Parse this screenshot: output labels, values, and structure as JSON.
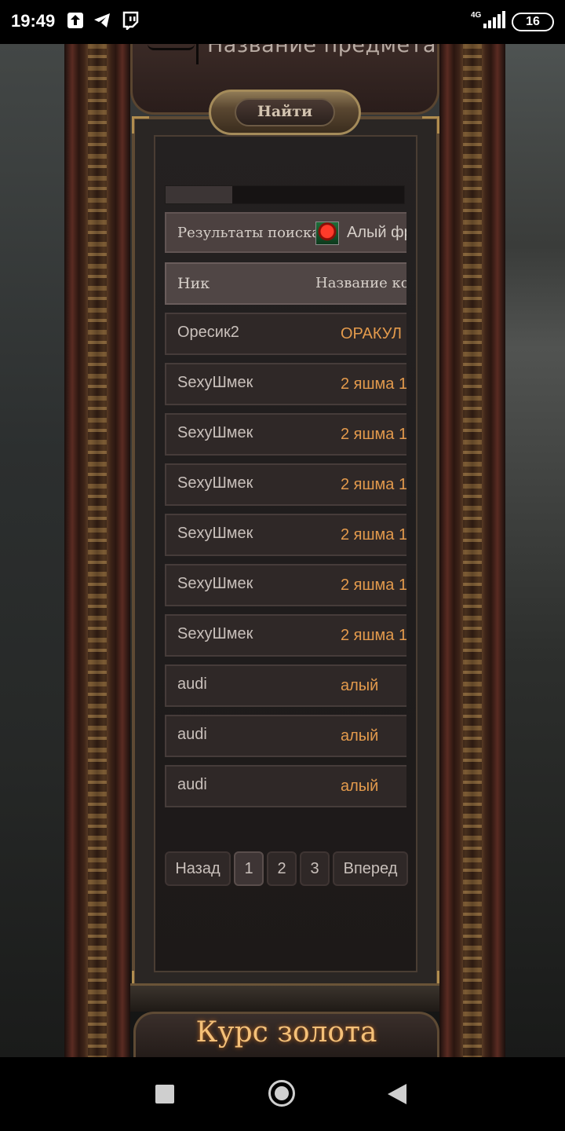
{
  "status_bar": {
    "time": "19:49",
    "network": "4G",
    "battery": "16",
    "icons": [
      "upload-icon",
      "telegram-icon",
      "twitch-icon",
      "signal-icon",
      "battery-icon"
    ]
  },
  "search": {
    "placeholder": "Название предмета",
    "button_label": "Найти"
  },
  "progress": {
    "fraction": 0.28
  },
  "results": {
    "label": "Результаты поиска:",
    "item_name": "Алый фр",
    "item_icon": "red-berry-icon"
  },
  "table": {
    "columns": [
      "Ник",
      "Название кота"
    ],
    "rows": [
      {
        "nick": "Оресик2",
        "name": "ОРАКУЛ"
      },
      {
        "nick": "SexyШмек",
        "name": "2 яшма 1"
      },
      {
        "nick": "SexyШмек",
        "name": "2 яшма 1"
      },
      {
        "nick": "SexyШмек",
        "name": "2 яшма 1"
      },
      {
        "nick": "SexyШмек",
        "name": "2 яшма 1"
      },
      {
        "nick": "SexyШмек",
        "name": "2 яшма 1"
      },
      {
        "nick": "SexyШмек",
        "name": "2 яшма 1"
      },
      {
        "nick": "audi",
        "name": "алый"
      },
      {
        "nick": "audi",
        "name": "алый"
      },
      {
        "nick": "audi",
        "name": "алый"
      }
    ]
  },
  "pagination": {
    "prev_label": "Назад",
    "pages": [
      "1",
      "2",
      "3"
    ],
    "active_page": "1",
    "next_label": "Вперед"
  },
  "footer": {
    "title": "Курс золота"
  },
  "colors": {
    "accent_orange": "#e39a4c",
    "gold_title": "#f4c078",
    "frame_bronze": "#5e4a34"
  }
}
